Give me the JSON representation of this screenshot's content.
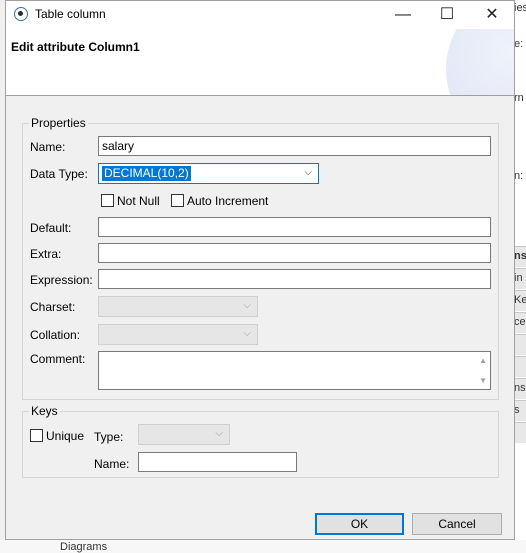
{
  "window": {
    "title": "Table column"
  },
  "header": {
    "title": "Edit attribute Column1"
  },
  "properties": {
    "legend": "Properties",
    "name_label": "Name:",
    "name_value": "salary",
    "datatype_label": "Data Type:",
    "datatype_value": "DECIMAL(10,2)",
    "not_null_label": "Not Null",
    "auto_increment_label": "Auto Increment",
    "default_label": "Default:",
    "extra_label": "Extra:",
    "expression_label": "Expression:",
    "charset_label": "Charset:",
    "collation_label": "Collation:",
    "comment_label": "Comment:"
  },
  "keys": {
    "legend": "Keys",
    "unique_label": "Unique",
    "type_label": "Type:",
    "name_label": "Name:"
  },
  "buttons": {
    "ok": "OK",
    "cancel": "Cancel"
  },
  "background": {
    "fragments": [
      "ies",
      "e:",
      "rn",
      "n:",
      "ns",
      "in",
      "Ke",
      "ce",
      "ns",
      "s"
    ],
    "bottom_text": "Diagrams"
  },
  "icons": {
    "app": "app-icon",
    "minimize": "minimize-icon",
    "maximize": "maximize-icon",
    "close": "close-icon",
    "dropdown": "chevron-down-icon"
  },
  "colors": {
    "accent": "#0078d7"
  }
}
